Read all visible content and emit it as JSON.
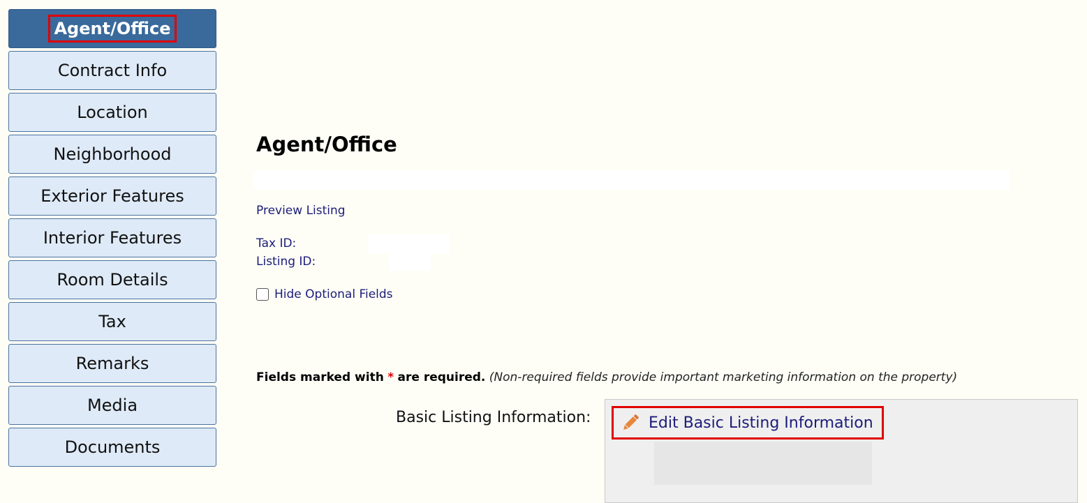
{
  "sidebar": {
    "items": [
      {
        "label": "Agent/Office",
        "active": true
      },
      {
        "label": "Contract Info"
      },
      {
        "label": "Location"
      },
      {
        "label": "Neighborhood"
      },
      {
        "label": "Exterior Features"
      },
      {
        "label": "Interior Features"
      },
      {
        "label": "Room Details"
      },
      {
        "label": "Tax"
      },
      {
        "label": "Remarks"
      },
      {
        "label": "Media"
      },
      {
        "label": "Documents"
      }
    ]
  },
  "main": {
    "title": "Agent/Office",
    "preview_link": "Preview Listing",
    "tax_id_label": "Tax ID:",
    "listing_id_label": "Listing ID:",
    "hide_optional_label": "Hide Optional Fields",
    "required_note": {
      "part1": "Fields marked with",
      "star": "*",
      "part2": "are required.",
      "italic": "(Non-required fields provide important marketing information on the property)"
    },
    "basic_info_label": "Basic Listing Information:",
    "edit_basic_label": "Edit Basic Listing Information"
  },
  "colors": {
    "active_nav": "#3a6a9c",
    "nav_bg": "#deeaf7",
    "link": "#1c1c7a",
    "highlight": "#e00000",
    "pencil": "#e8863a"
  },
  "icons": {
    "edit": "pencil-icon"
  }
}
